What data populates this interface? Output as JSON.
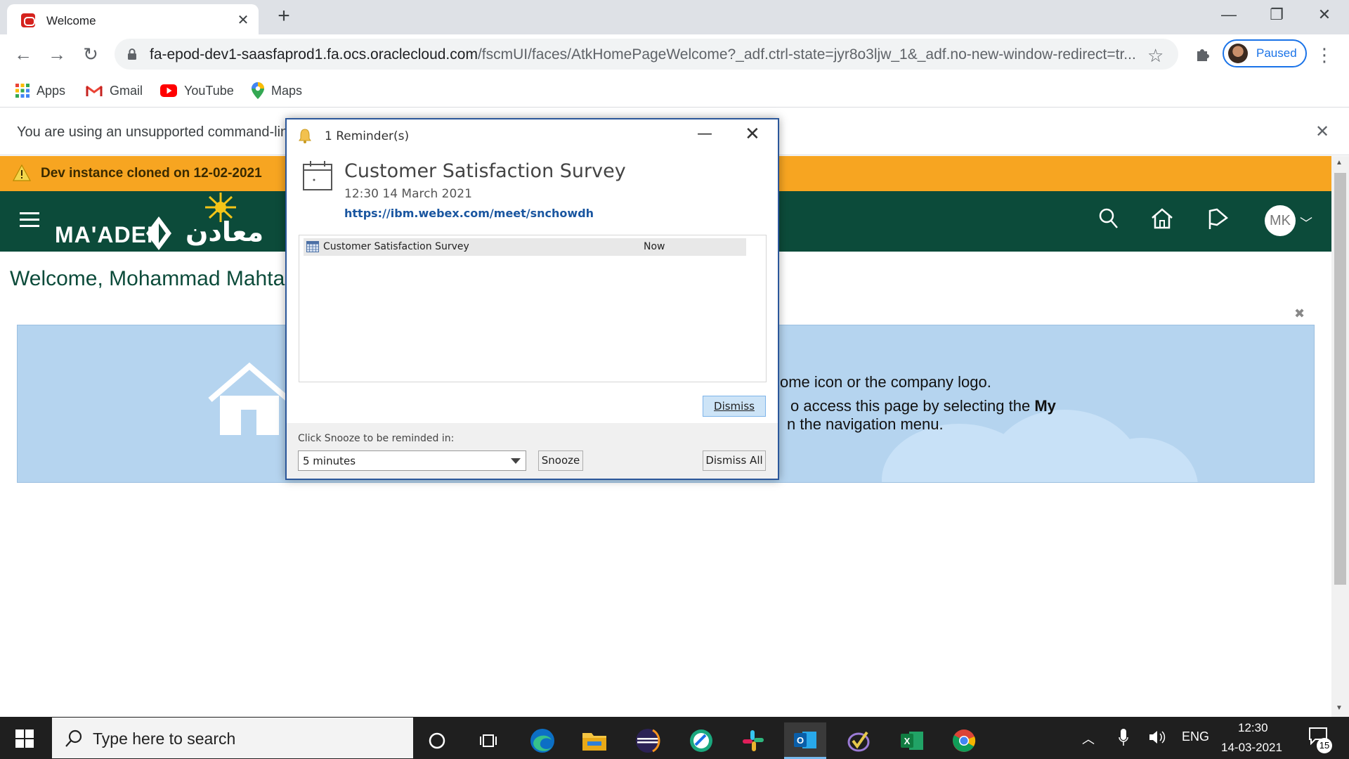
{
  "browser": {
    "tab_title": "Welcome",
    "url_host": "fa-epod-dev1-saasfaprod1.fa.ocs.oraclecloud.com",
    "url_path": "/fscmUI/faces/AtkHomePageWelcome?_adf.ctrl-state=jyr8o3ljw_1&_adf.no-new-window-redirect=tr...",
    "profile_status": "Paused",
    "bookmarks": [
      "Apps",
      "Gmail",
      "YouTube",
      "Maps"
    ],
    "infobar_text": "You are using an unsupported command-line flag: --ignore-certificate-errors. Stability and security will suffer."
  },
  "page": {
    "banner_text": "Dev instance cloned on 12-02-2021",
    "logo_text": "MA'ADEN",
    "logo_arabic": "معادن",
    "user_initials": "MK",
    "welcome_text": "Welcome, Mohammad Mahtab Khan!",
    "panel_line1": "ome icon or the company logo.",
    "panel_line2_pre": "o access this page by selecting the ",
    "panel_line2_bold": "My",
    "panel_line3": "n the navigation menu."
  },
  "reminder": {
    "window_title": "1 Reminder(s)",
    "subject": "Customer Satisfaction Survey",
    "datetime": "12:30 14 March 2021",
    "link": "https://ibm.webex.com/meet/snchowdh",
    "items": [
      {
        "subject": "Customer Satisfaction Survey",
        "due": "Now"
      }
    ],
    "dismiss_label": "Dismiss",
    "snooze_prompt": "Click Snooze to be reminded in:",
    "snooze_value": "5 minutes",
    "snooze_label": "Snooze",
    "dismiss_all_label": "Dismiss All"
  },
  "taskbar": {
    "search_placeholder": "Type here to search",
    "language": "ENG",
    "time": "12:30",
    "date": "14-03-2021",
    "notification_count": "15"
  },
  "colors": {
    "header_green": "#0c4b3a",
    "banner_orange": "#f7a521",
    "panel_blue": "#b5d4ef",
    "dialog_border": "#2b579a"
  }
}
